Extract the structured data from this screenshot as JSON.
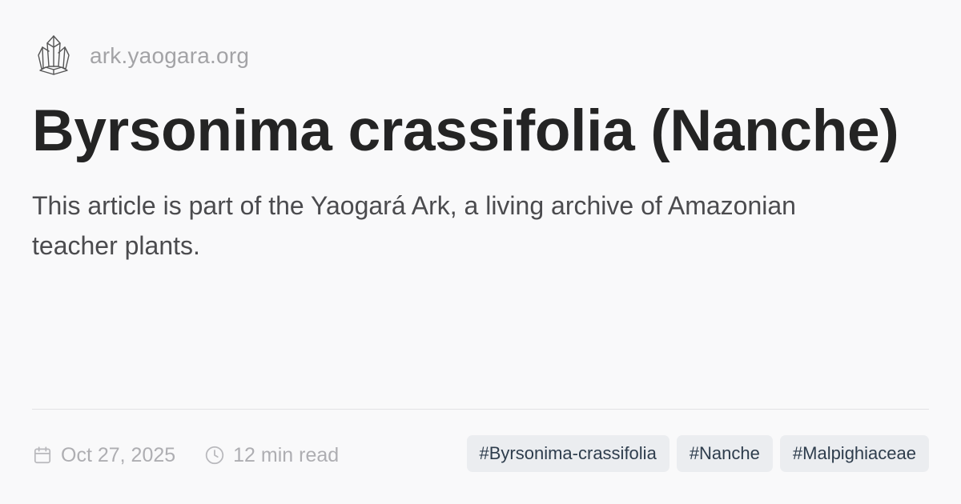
{
  "site": {
    "logo_icon": "crystal-cluster-icon",
    "domain": "ark.yaogara.org"
  },
  "article": {
    "title": "Byrsonima crassifolia (Nanche)",
    "description": "This article is part of the Yaogará Ark, a living archive of Amazonian teacher plants."
  },
  "meta": {
    "date_icon": "calendar-icon",
    "date": "Oct 27, 2025",
    "read_time_icon": "clock-icon",
    "read_time": "12 min read"
  },
  "tags": [
    "#Byrsonima-crassifolia",
    "#Nanche",
    "#Malpighiaceae"
  ]
}
